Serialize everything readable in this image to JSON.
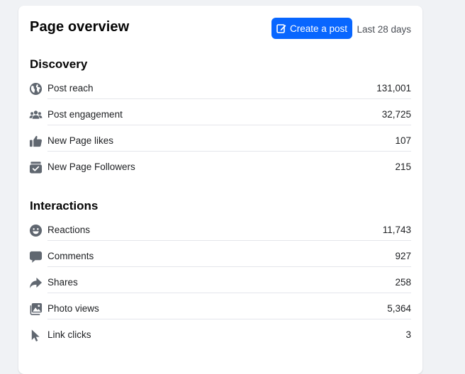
{
  "header": {
    "title": "Page overview",
    "create_button_label": "Create a post",
    "date_range": "Last 28 days"
  },
  "colors": {
    "accent": "#0866ff",
    "icon": "#606770",
    "divider": "#e4e6eb"
  },
  "discovery": {
    "title": "Discovery",
    "items": [
      {
        "label": "Post reach",
        "value": "131,001",
        "icon": "globe-icon"
      },
      {
        "label": "Post engagement",
        "value": "32,725",
        "icon": "people-icon"
      },
      {
        "label": "New Page likes",
        "value": "107",
        "icon": "thumbs-up-icon"
      },
      {
        "label": "New Page Followers",
        "value": "215",
        "icon": "follow-check-icon"
      }
    ]
  },
  "interactions": {
    "title": "Interactions",
    "items": [
      {
        "label": "Reactions",
        "value": "11,743",
        "icon": "smiley-icon"
      },
      {
        "label": "Comments",
        "value": "927",
        "icon": "speech-bubble-icon"
      },
      {
        "label": "Shares",
        "value": "258",
        "icon": "share-arrow-icon"
      },
      {
        "label": "Photo views",
        "value": "5,364",
        "icon": "photo-icon"
      },
      {
        "label": "Link clicks",
        "value": "3",
        "icon": "cursor-icon"
      }
    ]
  }
}
